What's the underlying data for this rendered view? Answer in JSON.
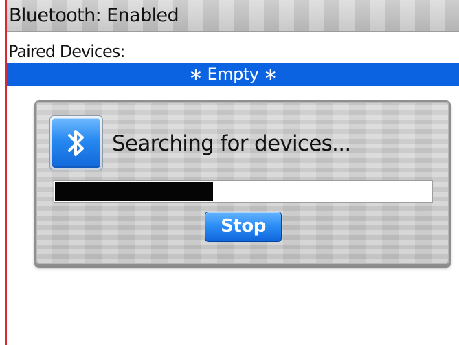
{
  "status_bar": {
    "text": "Bluetooth: Enabled"
  },
  "paired_devices": {
    "label": "Paired Devices:",
    "empty_text": "∗ Empty ∗"
  },
  "dialog": {
    "icon": "bluetooth-icon",
    "message": "Searching for devices...",
    "progress": 0.42,
    "stop_label": "Stop"
  },
  "colors": {
    "accent": "#0b63e1",
    "left_rule": "#d8283a",
    "progress_fill": "#050505"
  }
}
